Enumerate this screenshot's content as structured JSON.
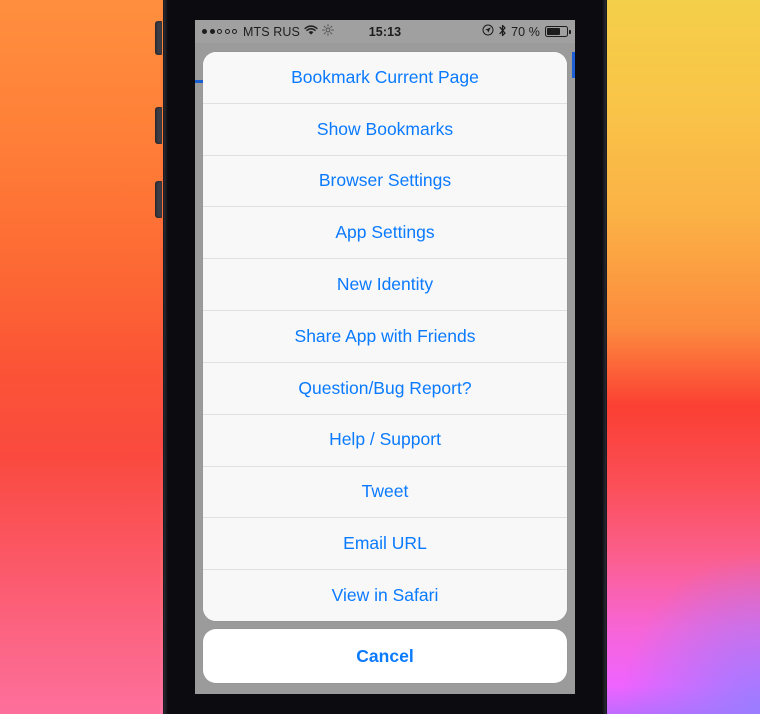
{
  "status_bar": {
    "signal_dots_filled": 2,
    "signal_dots_total": 5,
    "carrier": "MTS RUS",
    "wifi_icon": "wifi-icon",
    "extra_icon": "brightness-icon",
    "time": "15:13",
    "location_icon": "location-arrow-icon",
    "bluetooth_icon": "bluetooth-icon",
    "battery_percent": "70 %",
    "battery_level": 70
  },
  "action_sheet": {
    "items": [
      {
        "label": "Bookmark Current Page"
      },
      {
        "label": "Show Bookmarks"
      },
      {
        "label": "Browser Settings"
      },
      {
        "label": "App Settings"
      },
      {
        "label": "New Identity"
      },
      {
        "label": "Share App with Friends"
      },
      {
        "label": "Question/Bug Report?"
      },
      {
        "label": "Help / Support"
      },
      {
        "label": "Tweet"
      },
      {
        "label": "Email URL"
      },
      {
        "label": "View in Safari"
      }
    ],
    "cancel_label": "Cancel"
  },
  "colors": {
    "accent_blue": "#0a7aff",
    "sheet_bg": "#f8f8f8",
    "cancel_bg": "#ffffff",
    "screen_backdrop": "#9b9b9b",
    "status_bar_bg": "#a0a0a0",
    "progress_blue": "#1f5fd6"
  }
}
